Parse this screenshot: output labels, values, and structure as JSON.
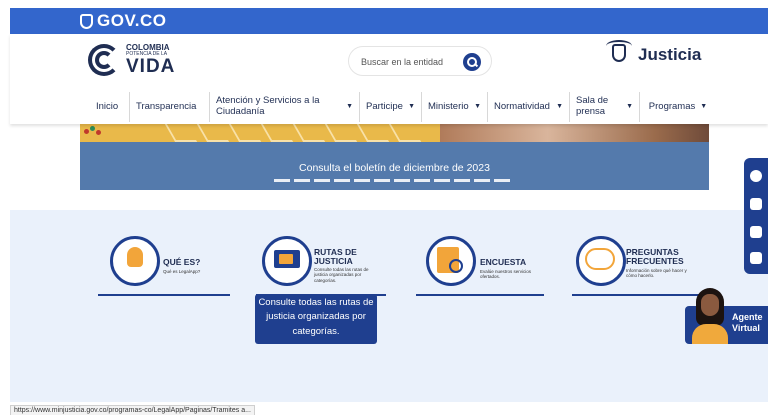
{
  "govbar": {
    "logo_text": "GOV.CO"
  },
  "brand": {
    "line1": "COLOMBIA",
    "line2": "POTENCIA DE LA",
    "line3": "VIDA"
  },
  "search": {
    "placeholder": "Buscar en la entidad"
  },
  "ministry": {
    "name": "Justicia"
  },
  "nav": [
    {
      "label": "Inicio",
      "has_caret": false
    },
    {
      "label": "Transparencia",
      "has_caret": false
    },
    {
      "label": "Atención y Servicios a la Ciudadanía",
      "has_caret": true
    },
    {
      "label": "Participe",
      "has_caret": true
    },
    {
      "label": "Ministerio",
      "has_caret": true
    },
    {
      "label": "Normatividad",
      "has_caret": true
    },
    {
      "label": "Sala de prensa",
      "has_caret": true
    },
    {
      "label": "Programas",
      "has_caret": true
    }
  ],
  "banner": {
    "caption": "Consulta el boletín de diciembre de 2023",
    "slide_count": 12
  },
  "cards": [
    {
      "title": "QUÉ ES?",
      "subtitle": "Qué es LegalApp?"
    },
    {
      "title": "RUTAS DE JUSTICIA",
      "subtitle": "Consulte todas las rutas de justicia organizadas por categorías."
    },
    {
      "title": "ENCUESTA",
      "subtitle": "Evalúe nuestros servicios ofertados."
    },
    {
      "title": "PREGUNTAS FRECUENTES",
      "subtitle": "Información sobre qué hacer y cómo hacerlo."
    }
  ],
  "tooltip": {
    "text": "Consulte todas las rutas de justicia organizadas por categorías."
  },
  "agent": {
    "label": "Agente Virtual"
  },
  "statusbar": {
    "url": "https://www.minjusticia.gov.co/programas-co/LegalApp/Paginas/Tramites a..."
  },
  "colors": {
    "gov_blue": "#3366cc",
    "navy": "#1f2d52",
    "accent_blue": "#1f3f8f",
    "banner_blue": "#547aac",
    "section_bg": "#eaf1fb"
  }
}
